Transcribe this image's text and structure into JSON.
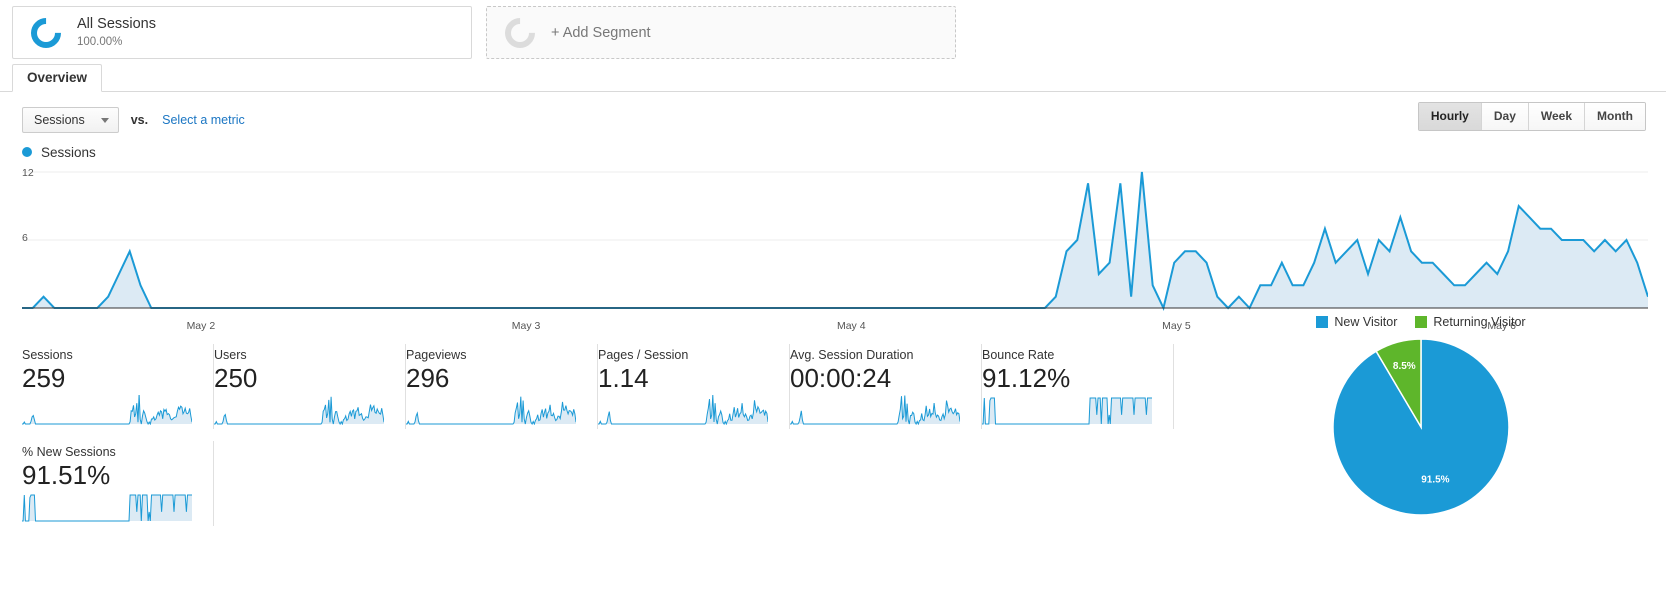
{
  "segments": {
    "primary": {
      "icon": "donut-icon",
      "title": "All Sessions",
      "percent": "100.00%"
    },
    "add": {
      "icon": "donut-placeholder-icon",
      "label": "+ Add Segment"
    }
  },
  "tabs": [
    {
      "label": "Overview",
      "active": true
    }
  ],
  "controls": {
    "metric_dropdown": "Sessions",
    "caret_icon": "chevron-down-icon",
    "vs_label": "vs.",
    "select_metric_link": "Select a metric",
    "granularity": [
      {
        "label": "Hourly",
        "active": true
      },
      {
        "label": "Day",
        "active": false
      },
      {
        "label": "Week",
        "active": false
      },
      {
        "label": "Month",
        "active": false
      }
    ]
  },
  "chart_legend": {
    "label": "Sessions",
    "color": "#1b9ad6"
  },
  "chart_data": {
    "type": "area",
    "title": "Sessions",
    "xlabel": "",
    "ylabel": "Sessions",
    "ylim": [
      0,
      12
    ],
    "yticks": [
      "6",
      "12"
    ],
    "grid": true,
    "legend": "top-left",
    "categories": [
      "May 2",
      "May 3",
      "May 4",
      "May 5",
      "May 6"
    ],
    "series": [
      {
        "name": "Sessions",
        "color": "#1b9ad6",
        "fill": "#dceaf4",
        "values": [
          0,
          0,
          1,
          0,
          0,
          0,
          0,
          0,
          1,
          3,
          5,
          2,
          0,
          0,
          0,
          0,
          0,
          0,
          0,
          0,
          0,
          0,
          0,
          0,
          0,
          0,
          0,
          0,
          0,
          0,
          0,
          0,
          0,
          0,
          0,
          0,
          0,
          0,
          0,
          0,
          0,
          0,
          0,
          0,
          0,
          0,
          0,
          0,
          0,
          0,
          0,
          0,
          0,
          0,
          0,
          0,
          0,
          0,
          0,
          0,
          0,
          0,
          0,
          0,
          0,
          0,
          0,
          0,
          0,
          0,
          0,
          0,
          0,
          0,
          0,
          0,
          0,
          0,
          0,
          0,
          0,
          0,
          0,
          0,
          0,
          0,
          0,
          0,
          0,
          0,
          0,
          0,
          0,
          0,
          0,
          0,
          1,
          5,
          6,
          11,
          3,
          4,
          11,
          1,
          12,
          2,
          0,
          4,
          5,
          5,
          4,
          1,
          0,
          1,
          0,
          2,
          2,
          4,
          2,
          2,
          4,
          7,
          4,
          5,
          6,
          3,
          6,
          5,
          8,
          5,
          4,
          4,
          3,
          2,
          2,
          3,
          4,
          3,
          5,
          9,
          8,
          7,
          7,
          6,
          6,
          6,
          5,
          6,
          5,
          6,
          4,
          1
        ]
      }
    ]
  },
  "metric_cards": [
    {
      "title": "Sessions",
      "value": "259"
    },
    {
      "title": "Users",
      "value": "250"
    },
    {
      "title": "Pageviews",
      "value": "296"
    },
    {
      "title": "Pages / Session",
      "value": "1.14"
    },
    {
      "title": "Avg. Session Duration",
      "value": "00:00:24"
    },
    {
      "title": "Bounce Rate",
      "value": "91.12%"
    },
    {
      "title": "% New Sessions",
      "value": "91.51%"
    }
  ],
  "pie_chart": {
    "type": "pie",
    "title": "",
    "legend": "top",
    "slices": [
      {
        "label": "New Visitor",
        "value": 91.5,
        "display": "91.5%",
        "color": "#1b9ad6"
      },
      {
        "label": "Returning Visitor",
        "value": 8.5,
        "display": "8.5%",
        "color": "#5eb62b"
      }
    ]
  }
}
